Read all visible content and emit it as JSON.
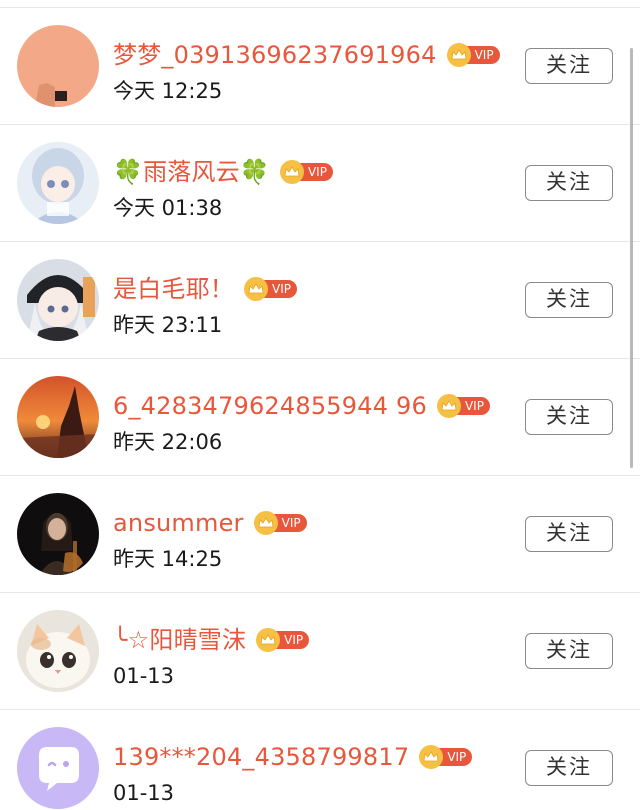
{
  "vip_label": "VIP",
  "follow_label": "关注",
  "colors": {
    "username": "#e8573c",
    "vip_badge": "#e8573c",
    "vip_crown": "#f5c043",
    "divider": "#e6e6e6"
  },
  "users": [
    {
      "name": "梦梦_03913696237691964",
      "time": "今天 12:25",
      "avatar": "salmon-square-avatar"
    },
    {
      "name": "🍀雨落风云🍀",
      "time": "今天 01:38",
      "avatar": "anime-girl-white-hair-avatar"
    },
    {
      "name": "是白毛耶！",
      "time": "昨天 23:11",
      "avatar": "anime-girl-black-hat-avatar"
    },
    {
      "name": "6_4283479624855944 96",
      "time": "昨天 22:06",
      "avatar": "sunset-silhouette-avatar"
    },
    {
      "name": "ansummer",
      "time": "昨天 14:25",
      "avatar": "dark-portrait-avatar"
    },
    {
      "name": "╰☆阳晴雪沫",
      "time": "01-13",
      "avatar": "white-cat-avatar"
    },
    {
      "name": "139***204_4358799817",
      "time": "01-13",
      "avatar": "chat-bubble-avatar"
    }
  ]
}
